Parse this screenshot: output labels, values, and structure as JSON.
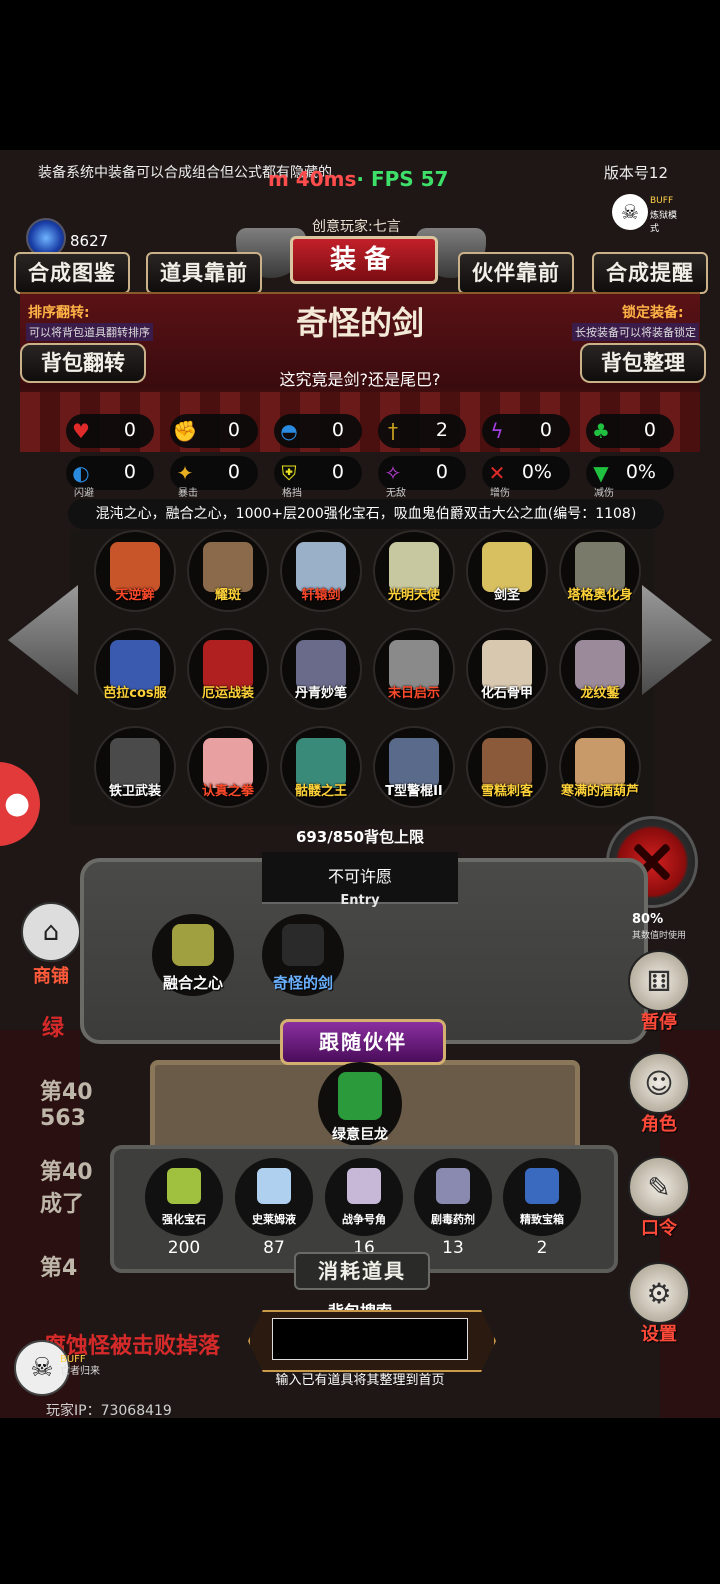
{
  "header": {
    "notice": "装备系统中装备可以合成组合但公式都有隐藏的",
    "ping": "m 40ms",
    "fps": "· FPS 57",
    "version": "版本号12",
    "buff_mode_label": "BUFF",
    "buff_mode_sub": "炼狱模式",
    "gem_count": "8627",
    "creator": "创意玩家:七言",
    "title": "装备"
  },
  "tabs": [
    {
      "label": "合成图鉴"
    },
    {
      "label": "道具靠前"
    },
    {
      "label": "伙伴靠前"
    },
    {
      "label": "合成提醒"
    }
  ],
  "item": {
    "name": "奇怪的剑",
    "description": "这究竟是剑?还是尾巴?",
    "skills": "混沌之心，融合之心，1000+层200强化宝石，吸血鬼伯爵双击大公之血(编号：1108)"
  },
  "left_side": {
    "label": "排序翻转:",
    "sub": "可以将背包道具翻转排序",
    "button": "背包翻转"
  },
  "right_side": {
    "label": "锁定装备:",
    "sub": "长按装备可以将装备锁定",
    "button": "背包整理"
  },
  "stats": [
    {
      "icon": "heart-icon",
      "value": "0",
      "sub": "",
      "color": "#e02a2a"
    },
    {
      "icon": "strength-icon",
      "value": "0",
      "sub": "",
      "color": "#e8c020"
    },
    {
      "icon": "helmet-icon",
      "value": "0",
      "sub": "",
      "color": "#2a8ae0"
    },
    {
      "icon": "sword-icon",
      "value": "2",
      "sub": "",
      "color": "#c8a020"
    },
    {
      "icon": "lightning-icon",
      "value": "0",
      "sub": "",
      "color": "#a040e0"
    },
    {
      "icon": "clover-icon",
      "value": "0",
      "sub": "",
      "color": "#20c040"
    },
    {
      "icon": "dodge-icon",
      "value": "0",
      "sub": "闪避",
      "color": "#2a8ae0"
    },
    {
      "icon": "crit-icon",
      "value": "0",
      "sub": "暴击",
      "color": "#e8b020"
    },
    {
      "icon": "block-icon",
      "value": "0",
      "sub": "格挡",
      "color": "#e8e020"
    },
    {
      "icon": "invincible-icon",
      "value": "0",
      "sub": "无敌",
      "color": "#c040e0"
    },
    {
      "icon": "damage-up-icon",
      "value": "0%",
      "sub": "增伤",
      "color": "#e02a2a"
    },
    {
      "icon": "damage-down-icon",
      "value": "0%",
      "sub": "减伤",
      "color": "#20c040"
    }
  ],
  "equipment": [
    {
      "name": "天逆鉾",
      "color": "#ff4a2a",
      "art": "#c8552a"
    },
    {
      "name": "耀斑",
      "color": "#ffd23a",
      "art": "#8a6a4a"
    },
    {
      "name": "轩辕剑",
      "color": "#ff4a2a",
      "art": "#9ab0c8"
    },
    {
      "name": "光明天使",
      "color": "#ffd23a",
      "art": "#c8c8a0"
    },
    {
      "name": "剑圣",
      "color": "#ffffff",
      "art": "#d8c060"
    },
    {
      "name": "塔格奥化身",
      "color": "#ffd23a",
      "art": "#7a7a6a"
    },
    {
      "name": "芭拉cos服",
      "color": "#ffd23a",
      "art": "#3a5ab0"
    },
    {
      "name": "厄运战装",
      "color": "#ffd23a",
      "art": "#b02020"
    },
    {
      "name": "丹青妙笔",
      "color": "#ffffff",
      "art": "#6a6a8a"
    },
    {
      "name": "末日启示",
      "color": "#ff4a2a",
      "art": "#8a8a8a"
    },
    {
      "name": "化石骨甲",
      "color": "#ffffff",
      "art": "#d8c8b0"
    },
    {
      "name": "龙纹錾",
      "color": "#ffd23a",
      "art": "#9a8a9a"
    },
    {
      "name": "铁卫武装",
      "color": "#ffffff",
      "art": "#4a4a4a"
    },
    {
      "name": "认真之拳",
      "color": "#ff4a2a",
      "art": "#e8a0a0"
    },
    {
      "name": "骷髅之王",
      "color": "#ffd23a",
      "art": "#3a8a7a"
    },
    {
      "name": "T型警棍II",
      "color": "#ffffff",
      "art": "#5a6a8a"
    },
    {
      "name": "雪糕刺客",
      "color": "#ffd23a",
      "art": "#8a5a3a"
    },
    {
      "name": "寒满的酒葫芦",
      "color": "#ffd23a",
      "art": "#c89a6a"
    }
  ],
  "bag_limit": "693/850背包上限",
  "wish": {
    "label": "不可许愿",
    "entry": "Entry"
  },
  "panel_items": [
    {
      "name": "融合之心",
      "color": "#ffffff",
      "art": "#a0a040"
    },
    {
      "name": "奇怪的剑",
      "color": "#6ab0ff",
      "art": "#2a2a2a"
    }
  ],
  "follow": {
    "title": "跟随伙伴",
    "companion": "绿意巨龙"
  },
  "consumables": {
    "title": "消耗道具",
    "items": [
      {
        "name": "强化宝石",
        "count": "200",
        "art": "#a0c040"
      },
      {
        "name": "史莱姆液",
        "count": "87",
        "art": "#b0d0f0"
      },
      {
        "name": "战争号角",
        "count": "16",
        "art": "#c8b8d8"
      },
      {
        "name": "剧毒药剂",
        "count": "13",
        "art": "#8a8ab0"
      },
      {
        "name": "精致宝箱",
        "count": "2",
        "art": "#3a6ac0"
      }
    ]
  },
  "search": {
    "label": "背包搜索",
    "placeholder": "",
    "hint": "输入已有道具将其整理到首页"
  },
  "right_menu": [
    {
      "name": "dice",
      "label": "暂停",
      "glyph": "⚅"
    },
    {
      "name": "role",
      "label": "角色",
      "glyph": "☺"
    },
    {
      "name": "command",
      "label": "口令",
      "glyph": "✎"
    },
    {
      "name": "settings",
      "label": "设置",
      "glyph": "⚙"
    }
  ],
  "right_percent": "80%",
  "right_percent_sub": "其数值时使用",
  "shop": {
    "label": "商铺"
  },
  "background_log": {
    "green_line": "绿",
    "line1": "第40",
    "line1b": "563",
    "line2": "第40",
    "line2b": "成了",
    "line3": "第4",
    "red_line": "腐蚀怪被击败掉落"
  },
  "bottom": {
    "buff": "BUFF",
    "buff_sub": "亡者归来",
    "player_ip": "玩家IP：73068419"
  }
}
